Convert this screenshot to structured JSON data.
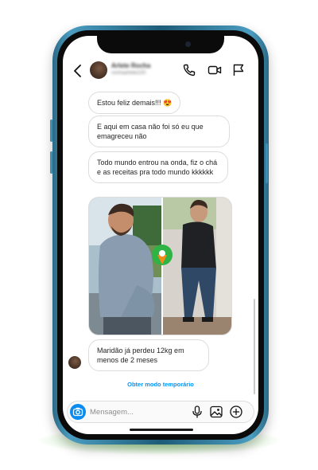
{
  "header": {
    "contact_name": "Arlete Rocha",
    "contact_handle": "rochaarlete220"
  },
  "messages": [
    {
      "text": "Estou feliz demais!!! 😍"
    },
    {
      "text": "E aqui em casa não foi só eu que emagreceu não"
    },
    {
      "text": "Todo mundo entrou na onda, fiz o chá e as receitas pra todo mundo kkkkkk"
    },
    {
      "text": "Maridão já perdeu 12kg em menos de 2 meses"
    }
  ],
  "temporary_mode_link": "Obter modo temporário",
  "composer": {
    "placeholder": "Mensagem..."
  },
  "icons": {
    "back": "chevron-left-icon",
    "call": "phone-icon",
    "video": "video-camera-icon",
    "flag": "flag-icon",
    "camera": "camera-icon",
    "mic": "microphone-icon",
    "gallery": "image-icon",
    "add": "plus-circle-icon"
  },
  "colors": {
    "accent": "#0095f6",
    "camera_button": "#0a8cf0",
    "phone_frame": "#2b6a86",
    "glow": "#5ac83c"
  }
}
